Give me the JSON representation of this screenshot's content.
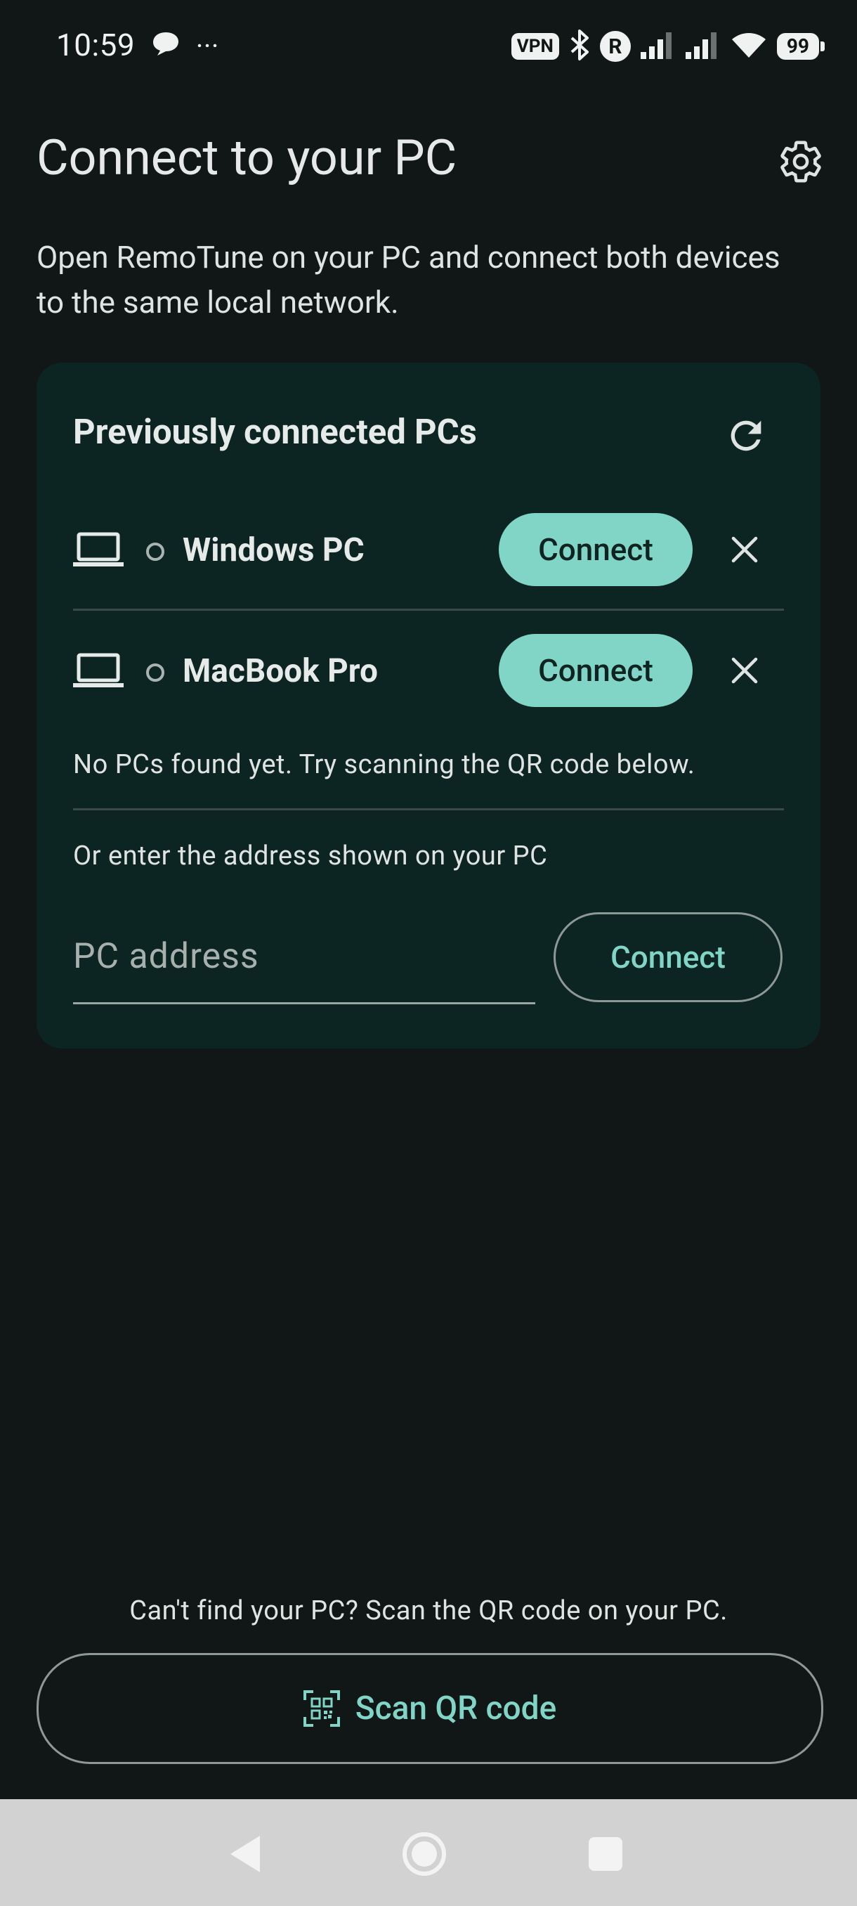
{
  "status_bar": {
    "time": "10:59",
    "overflow": "···",
    "vpn": "VPN",
    "r_badge": "R",
    "battery": "99"
  },
  "header": {
    "title": "Connect to your PC",
    "settings_icon": "gear-icon"
  },
  "subtitle": "Open RemoTune on your PC and connect both devices to the same local network.",
  "card": {
    "title": "Previously connected PCs",
    "refresh_icon": "refresh-icon",
    "pcs": [
      {
        "name": "Windows PC",
        "connect_label": "Connect"
      },
      {
        "name": "MacBook Pro",
        "connect_label": "Connect"
      }
    ],
    "empty_message": "No PCs found yet. Try scanning the QR code below.",
    "manual_label": "Or enter the address shown on your PC",
    "address_placeholder": "PC address",
    "address_value": "",
    "manual_connect_label": "Connect"
  },
  "footer": {
    "hint": "Can't find your PC? Scan the QR code on your PC.",
    "scan_label": "Scan QR code"
  },
  "colors": {
    "background": "#111716",
    "card": "#0c2422",
    "accent": "#80d5c7",
    "nav_bar": "#d2d2d2"
  }
}
